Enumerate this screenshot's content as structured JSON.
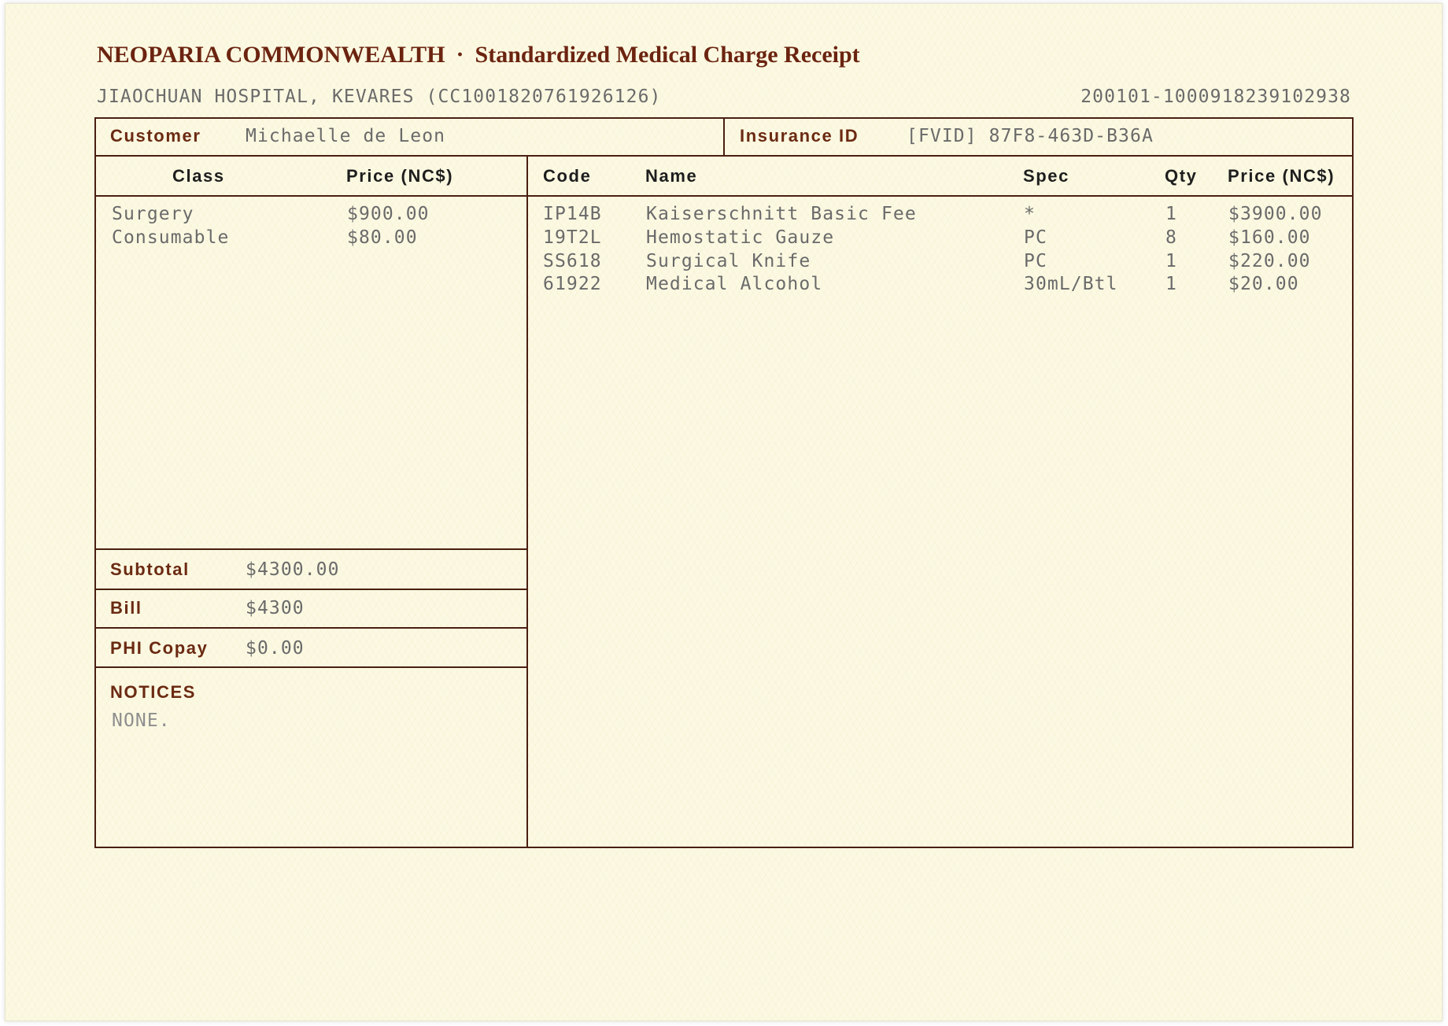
{
  "header": {
    "issuer": "NEOPARIA COMMONWEALTH",
    "separator": "·",
    "title": "Standardized Medical Charge Receipt",
    "hospital": "JIAOCHUAN HOSPITAL, KEVARES (CC1001820761926126)",
    "receipt_no": "200101-1000918239102938"
  },
  "customer": {
    "label": "Customer",
    "name": "Michaelle de Leon"
  },
  "insurance": {
    "label": "Insurance ID",
    "value": "[FVID] 87F8-463D-B36A"
  },
  "class_table": {
    "headers": {
      "class": "Class",
      "price": "Price (NC$)"
    },
    "rows": [
      {
        "class": "Surgery",
        "price": "$900.00"
      },
      {
        "class": "Consumable",
        "price": "$80.00"
      }
    ]
  },
  "items_table": {
    "headers": {
      "code": "Code",
      "name": "Name",
      "spec": "Spec",
      "qty": "Qty",
      "price": "Price (NC$)"
    },
    "rows": [
      {
        "code": "IP14B",
        "name": "Kaiserschnitt Basic Fee",
        "spec": "*",
        "qty": "1",
        "price": "$3900.00"
      },
      {
        "code": "19T2L",
        "name": "Hemostatic Gauze",
        "spec": "PC",
        "qty": "8",
        "price": "$160.00"
      },
      {
        "code": "SS618",
        "name": "Surgical Knife",
        "spec": "PC",
        "qty": "1",
        "price": "$220.00"
      },
      {
        "code": "61922",
        "name": "Medical Alcohol",
        "spec": "30mL/Btl",
        "qty": "1",
        "price": "$20.00"
      }
    ]
  },
  "totals": {
    "subtotal_label": "Subtotal",
    "subtotal": "$4300.00",
    "bill_label": "Bill",
    "bill": "$4300",
    "copay_label": "PHI Copay",
    "copay": "$0.00"
  },
  "notices": {
    "label": "NOTICES",
    "text": "NONE."
  },
  "colors": {
    "paper": "#fcf9e3",
    "accent": "#6b2410",
    "label": "#6b2a12",
    "rule": "#4a1f10",
    "value_text": "#6a6a6a"
  }
}
